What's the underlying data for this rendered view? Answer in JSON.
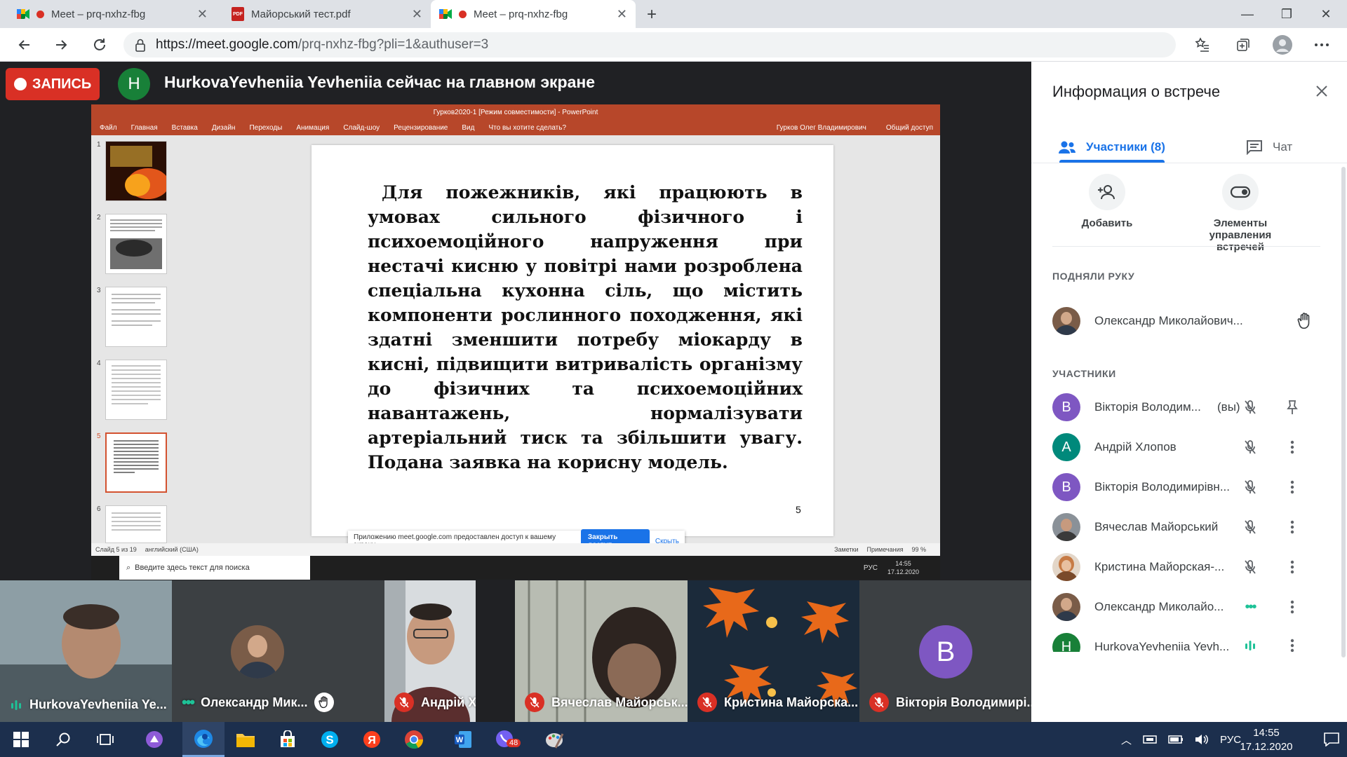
{
  "browser": {
    "tabs": [
      {
        "title": "Meet – prq-nxhz-fbg",
        "icon": "meet-icon",
        "recording": true,
        "active": false
      },
      {
        "title": "Майорський тест.pdf",
        "icon": "pdf-icon",
        "recording": false,
        "active": false
      },
      {
        "title": "Meet – prq-nxhz-fbg",
        "icon": "meet-icon",
        "recording": true,
        "active": true
      }
    ],
    "url_host": "https://meet.google.com",
    "url_path": "/prq-nxhz-fbg?pli=1&authuser=3",
    "new_tab": "+"
  },
  "meet": {
    "record_label": "ЗАПИСЬ",
    "presenter_initial": "H",
    "presenter_line": "HurkovaYevheniia Yevheniia сейчас на главном экране"
  },
  "ppt": {
    "window_title": "Гурков2020-1 [Режим совместимости] - PowerPoint",
    "ribbon_tabs": [
      "Файл",
      "Главная",
      "Вставка",
      "Дизайн",
      "Переходы",
      "Анимация",
      "Слайд-шоу",
      "Рецензирование",
      "Вид",
      "Что вы хотите сделать?"
    ],
    "ribbon_user": "Гурков Олег Владимирович",
    "ribbon_share": "Общий доступ",
    "thumb_numbers": [
      "1",
      "2",
      "3",
      "4",
      "5",
      "6"
    ],
    "selected_slide": 5,
    "slide_text": "Для пожежників, які працюють в умовах сильного фізичного і психоемоційного напруження при нестачі кисню у повітрі нами розроблена спеціальна кухонна сіль, що містить компоненти рослинного походження, які здатні зменшити потребу міокарду в кисні, підвищити витривалість організму до фізичних та психоемоційних навантажень, нормалізувати артеріальний тиск та збільшити увагу. Подана заявка на корисну модель.",
    "slide_number": "5",
    "status_slide": "Слайд 5 из 19",
    "status_lang": "английский (США)",
    "status_notes": "Заметки",
    "status_comments": "Примечания",
    "status_zoom": "99 %",
    "share_notice": "Приложению meet.google.com предоставлен доступ к вашему экрану.",
    "share_stop": "Закрыть доступ",
    "share_hide": "Скрыть",
    "taskbar_search": "Введите здесь текст для поиска",
    "taskbar_lang": "РУС",
    "taskbar_time": "14:55",
    "taskbar_date": "17.12.2020"
  },
  "tiles": [
    {
      "name": "HurkovaYevheniia Ye...",
      "status": "speaking"
    },
    {
      "name": "Олександр Мик...",
      "status": "hand"
    },
    {
      "name": "Андрій Хлопов",
      "status": "muted"
    },
    {
      "name": "Вячеслав Майорськ...",
      "status": "muted"
    },
    {
      "name": "Кристина Майорска...",
      "status": "muted"
    },
    {
      "name": "Вікторія Володимирі...",
      "status": "muted",
      "initial": "В"
    }
  ],
  "panel": {
    "title": "Информация о встрече",
    "tab_people": "Участники (8)",
    "tab_chat": "Чат",
    "action_add": "Добавить",
    "action_controls": "Элементы управления встречей",
    "raised_header": "ПОДНЯЛИ РУКУ",
    "raised": [
      {
        "name": "Олександр Миколайович..."
      }
    ],
    "participants_header": "УЧАСТНИКИ",
    "participants": [
      {
        "initial": "В",
        "name": "Вікторія Володим...",
        "you": "(вы)",
        "color": "#7e57c2",
        "status": "muted",
        "action": "pin"
      },
      {
        "initial": "А",
        "name": "Андрій Хлопов",
        "color": "#00897b",
        "status": "muted",
        "action": "more"
      },
      {
        "initial": "В",
        "name": "Вікторія Володимирівн...",
        "color": "#7e57c2",
        "status": "muted",
        "action": "more"
      },
      {
        "initial": "",
        "name": "Вячеслав Майорський",
        "color": "#5d6b78",
        "status": "muted",
        "action": "more"
      },
      {
        "initial": "",
        "name": "Кристина Майорская-...",
        "color": "#c77b45",
        "status": "muted",
        "action": "more"
      },
      {
        "initial": "",
        "name": "Олександр Миколайо...",
        "color": "#7a5c48",
        "status": "dots",
        "action": "more"
      },
      {
        "initial": "H",
        "name": "HurkovaYevheniia Yevh...",
        "color": "#188038",
        "status": "speaking",
        "action": "more"
      }
    ]
  },
  "windows": {
    "lang": "РУС",
    "time": "14:55",
    "date": "17.12.2020",
    "viber_badge": "48"
  },
  "colors": {
    "meet_bg": "#202124",
    "accent_blue": "#1a73e8",
    "record_red": "#d93025",
    "ppt_orange": "#b7472a",
    "taskbar": "#1c2f4d"
  }
}
